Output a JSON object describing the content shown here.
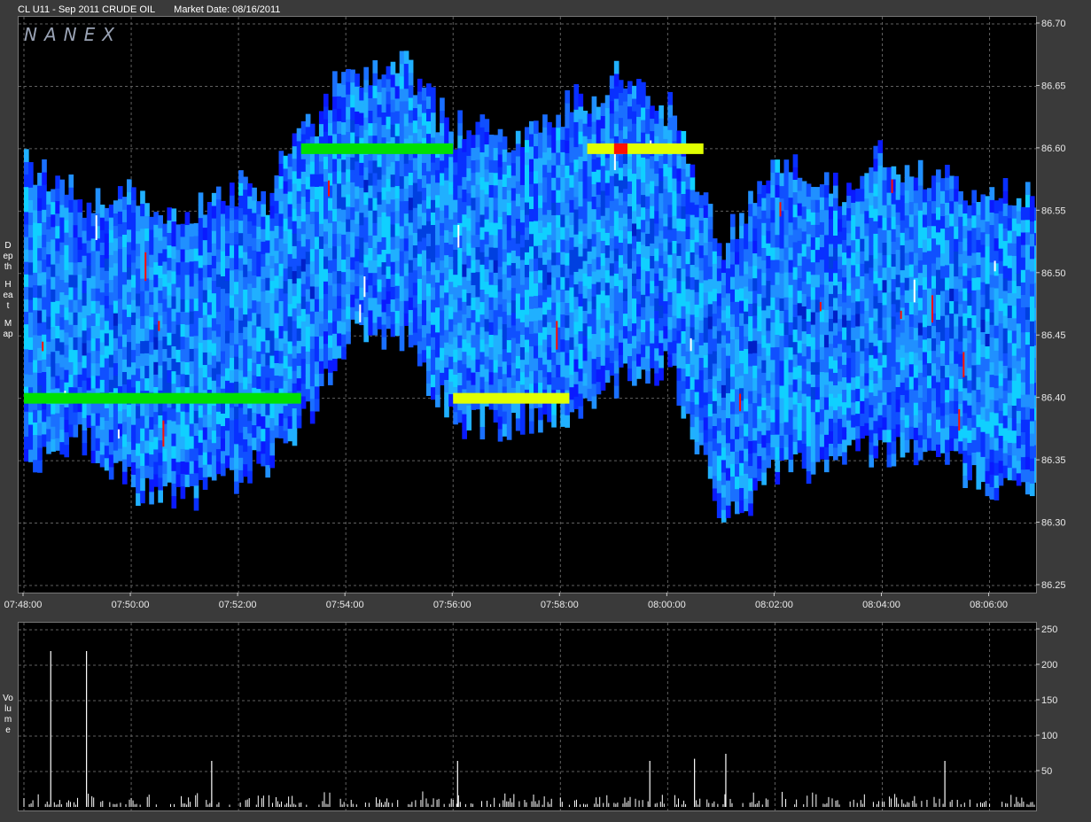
{
  "header": {
    "symbol": "CL U11 - Sep 2011 CRUDE OIL",
    "market_date": "Market Date: 08/16/2011"
  },
  "logo": "NANEX",
  "side_labels": {
    "heat": [
      "Depth",
      "Heat",
      "Map"
    ],
    "volume": "Volume"
  },
  "colors": {
    "background": "#000000",
    "panel_border": "#777777",
    "grid": "#606060",
    "heat_low": "#1030ff",
    "heat_mid": "#00e0ff",
    "heat_high_green": "#00e000",
    "heat_yellow": "#e0ff00",
    "heat_red": "#ff1000",
    "volume_bar": "#ffffff"
  },
  "chart_data": [
    {
      "type": "heatmap",
      "title": "Depth Heat Map",
      "x": [
        "07:48:00",
        "07:50:00",
        "07:52:00",
        "07:54:00",
        "07:56:00",
        "07:58:00",
        "08:00:00",
        "08:02:00",
        "08:04:00",
        "08:06:00"
      ],
      "x_range": [
        "07:48:00",
        "08:06:50"
      ],
      "y_ticks": [
        "86.70",
        "86.65",
        "86.60",
        "86.55",
        "86.50",
        "86.45",
        "86.40",
        "86.35",
        "86.30",
        "86.25"
      ],
      "ylim": [
        86.25,
        86.7
      ],
      "grid": true,
      "depth_envelope": [
        {
          "t": "07:48:00",
          "low": 86.35,
          "high": 86.59
        },
        {
          "t": "07:49:00",
          "low": 86.37,
          "high": 86.55
        },
        {
          "t": "07:50:00",
          "low": 86.33,
          "high": 86.56
        },
        {
          "t": "07:51:00",
          "low": 86.32,
          "high": 86.54
        },
        {
          "t": "07:52:00",
          "low": 86.34,
          "high": 86.57
        },
        {
          "t": "07:52:30",
          "low": 86.35,
          "high": 86.56
        },
        {
          "t": "07:53:10",
          "low": 86.38,
          "high": 86.61
        },
        {
          "t": "07:54:00",
          "low": 86.45,
          "high": 86.65
        },
        {
          "t": "07:55:00",
          "low": 86.45,
          "high": 86.66
        },
        {
          "t": "07:56:00",
          "low": 86.38,
          "high": 86.61
        },
        {
          "t": "07:57:00",
          "low": 86.38,
          "high": 86.61
        },
        {
          "t": "07:58:00",
          "low": 86.39,
          "high": 86.63
        },
        {
          "t": "07:59:00",
          "low": 86.41,
          "high": 86.65
        },
        {
          "t": "08:00:00",
          "low": 86.43,
          "high": 86.63
        },
        {
          "t": "08:01:00",
          "low": 86.3,
          "high": 86.52
        },
        {
          "t": "08:02:00",
          "low": 86.34,
          "high": 86.59
        },
        {
          "t": "08:03:00",
          "low": 86.35,
          "high": 86.56
        },
        {
          "t": "08:04:00",
          "low": 86.36,
          "high": 86.59
        },
        {
          "t": "08:05:00",
          "low": 86.35,
          "high": 86.57
        },
        {
          "t": "08:06:00",
          "low": 86.33,
          "high": 86.56
        }
      ],
      "strong_levels": [
        {
          "price": 86.4,
          "from": "07:48:00",
          "to": "07:53:10",
          "color": "green"
        },
        {
          "price": 86.4,
          "from": "07:56:00",
          "to": "07:58:10",
          "color": "yellow"
        },
        {
          "price": 86.6,
          "from": "07:53:10",
          "to": "07:56:00",
          "color": "green"
        },
        {
          "price": 86.6,
          "from": "07:58:30",
          "to": "08:00:40",
          "color": "yellow"
        },
        {
          "price": 86.6,
          "from": "07:59:00",
          "to": "07:59:15",
          "color": "red"
        }
      ]
    },
    {
      "type": "bar",
      "title": "Volume",
      "ylabel": "Volume",
      "y_ticks": [
        "250",
        "200",
        "150",
        "100",
        "50"
      ],
      "ylim": [
        0,
        250
      ],
      "x_range": [
        "07:48:00",
        "08:06:50"
      ],
      "spikes": [
        {
          "t": "07:48:30",
          "v": 220
        },
        {
          "t": "07:49:10",
          "v": 220
        },
        {
          "t": "07:51:30",
          "v": 65
        },
        {
          "t": "07:56:05",
          "v": 65
        },
        {
          "t": "07:59:40",
          "v": 65
        },
        {
          "t": "08:00:30",
          "v": 68
        },
        {
          "t": "08:01:05",
          "v": 75
        },
        {
          "t": "08:05:10",
          "v": 65
        }
      ]
    }
  ]
}
